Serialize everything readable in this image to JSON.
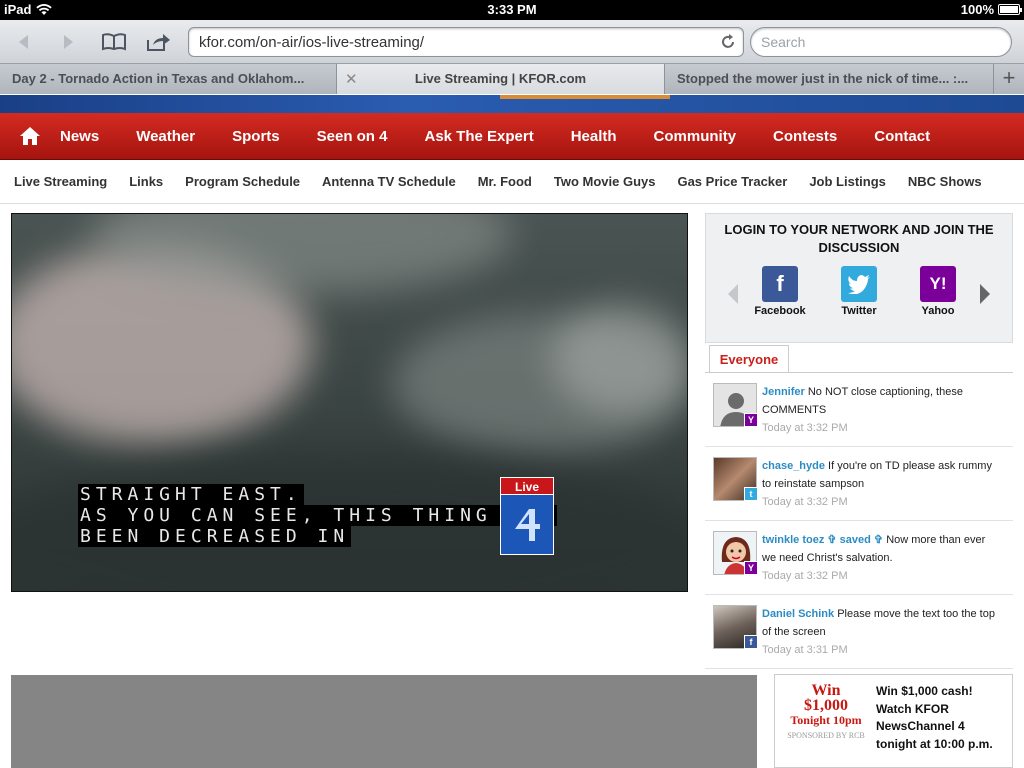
{
  "status_bar": {
    "device": "iPad",
    "time": "3:33 PM",
    "battery": "100%"
  },
  "browser": {
    "url": "kfor.com/on-air/ios-live-streaming/",
    "search_placeholder": "Search",
    "tabs": [
      {
        "title": "Day 2 - Tornado Action in Texas and Oklahom..."
      },
      {
        "title": "Live Streaming | KFOR.com",
        "active": true
      },
      {
        "title": "Stopped the mower just in the nick of time... :..."
      }
    ]
  },
  "main_nav": [
    "News",
    "Weather",
    "Sports",
    "Seen on 4",
    "Ask The Expert",
    "Health",
    "Community",
    "Contests",
    "Contact"
  ],
  "sub_nav": [
    "Live Streaming",
    "Links",
    "Program Schedule",
    "Antenna TV Schedule",
    "Mr. Food",
    "Two Movie Guys",
    "Gas Price Tracker",
    "Job Listings",
    "NBC Shows"
  ],
  "video": {
    "caption_lines": [
      "STRAIGHT EAST.",
      "AS YOU CAN SEE, THIS THING HAS",
      "BEEN DECREASED IN"
    ],
    "live_label": "Live"
  },
  "login": {
    "heading": "LOGIN TO YOUR NETWORK AND JOIN THE DISCUSSION",
    "networks": [
      {
        "name": "Facebook",
        "color": "#3b5998"
      },
      {
        "name": "Twitter",
        "color": "#33aadd"
      },
      {
        "name": "Yahoo",
        "color": "#7b0099"
      }
    ]
  },
  "comments_tab": "Everyone",
  "comments": [
    {
      "user": "Jennifer",
      "text": "No NOT close captioning, these COMMENTS",
      "time": "Today at 3:32 PM",
      "badge": "yahoo"
    },
    {
      "user": "chase_hyde",
      "text": "If you're on TD please ask rummy to reinstate sampson",
      "time": "Today at 3:32 PM",
      "badge": "twitter"
    },
    {
      "user": "twinkle toez ✞ saved ✞",
      "text": "Now more than ever we need Christ's salvation.",
      "time": "Today at 3:32 PM",
      "badge": "yahoo"
    },
    {
      "user": "Daniel Schink",
      "text": "Please move the text too the top of the screen",
      "time": "Today at 3:31 PM",
      "badge": "facebook"
    }
  ],
  "promo": {
    "image_win": "Win",
    "image_amount": "$1,000",
    "image_time": "Tonight 10pm",
    "image_sponsor": "SPONSORED BY RCB",
    "text": "Win $1,000 cash! Watch KFOR NewsChannel 4 tonight at 10:00 p.m."
  },
  "colors": {
    "nav_red": "#b8201a",
    "link_blue": "#2b8cc4",
    "everyone_red": "#c9201b"
  }
}
